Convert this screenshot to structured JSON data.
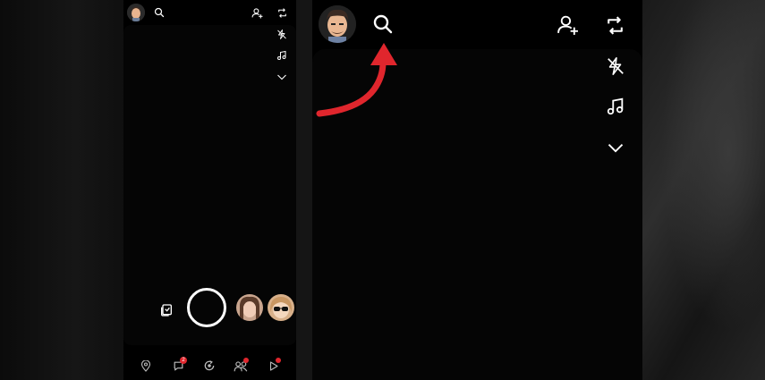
{
  "left_phone": {
    "top_bar": {
      "avatar": "bitmoji-avatar",
      "search_icon": "search-icon",
      "add_friend_icon": "add-friend-icon",
      "flip_camera_icon": "flip-camera-icon"
    },
    "side_tools": [
      "flash-off-icon",
      "music-icon",
      "chevron-down-icon"
    ],
    "camera": {
      "memories_icon": "memories-icon",
      "capture_button": "capture-button",
      "lenses": [
        "lens-1",
        "lens-2"
      ]
    },
    "bottom_nav": {
      "items": [
        {
          "icon": "map-icon",
          "badge": ""
        },
        {
          "icon": "chat-icon",
          "badge": "2"
        },
        {
          "icon": "camera-icon",
          "badge": ""
        },
        {
          "icon": "stories-icon",
          "badge": ""
        },
        {
          "icon": "spotlight-icon",
          "badge": ""
        }
      ],
      "badge_color": "#e0262d"
    }
  },
  "right_phone": {
    "top_bar": {
      "avatar": "bitmoji-avatar",
      "search_icon": "search-icon",
      "add_friend_icon": "add-friend-icon",
      "flip_camera_icon": "flip-camera-icon"
    },
    "side_tools": [
      "flash-off-icon",
      "music-icon",
      "chevron-down-icon"
    ],
    "annotation": {
      "type": "arrow",
      "color": "#e0262d",
      "points_to": "search-icon"
    }
  }
}
